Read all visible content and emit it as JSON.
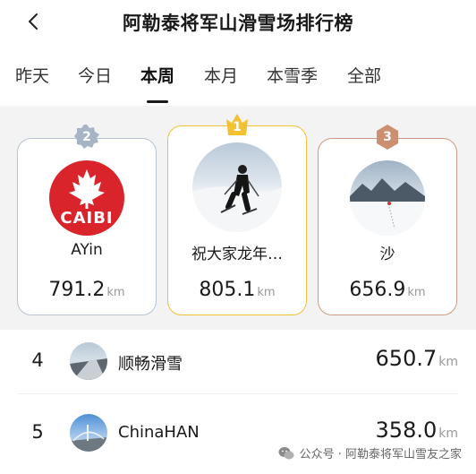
{
  "header": {
    "title": "阿勒泰将军山滑雪场排行榜",
    "back_icon": "chevron-left-icon"
  },
  "tabs": [
    {
      "label": "昨天",
      "active": false
    },
    {
      "label": "今日",
      "active": false
    },
    {
      "label": "本周",
      "active": true
    },
    {
      "label": "本月",
      "active": false
    },
    {
      "label": "本雪季",
      "active": false
    },
    {
      "label": "全部",
      "active": false
    }
  ],
  "podium": {
    "second": {
      "rank": "2",
      "name": "AYin",
      "distance": "791.2",
      "unit": "km",
      "avatar_text": "CAIBI",
      "avatar_icon": "maple-leaf-icon",
      "badge_color": "#a6b4c6"
    },
    "first": {
      "rank": "1",
      "name": "祝大家龙年…",
      "distance": "805.1",
      "unit": "km",
      "avatar_icon": "skier-photo",
      "badge_color": "#f2c233"
    },
    "third": {
      "rank": "3",
      "name": "沙",
      "distance": "656.9",
      "unit": "km",
      "avatar_icon": "snowy-lake-photo",
      "badge_color": "#cc8f72"
    }
  },
  "list": [
    {
      "rank": "4",
      "name": "顺畅滑雪",
      "distance": "650.7",
      "unit": "km",
      "avatar_icon": "road-photo"
    },
    {
      "rank": "5",
      "name": "ChinaHAN",
      "distance": "358.0",
      "unit": "km",
      "avatar_icon": "bridge-photo"
    }
  ],
  "watermark": {
    "text": "公众号 · 阿勒泰将军山雪友之家",
    "icon": "wechat-icon"
  },
  "colors": {
    "silver": "#b6c3d2",
    "gold": "#f0c23a",
    "bronze": "#cf9b83",
    "brand_red": "#d9242b",
    "background": "#f3f3f3"
  }
}
